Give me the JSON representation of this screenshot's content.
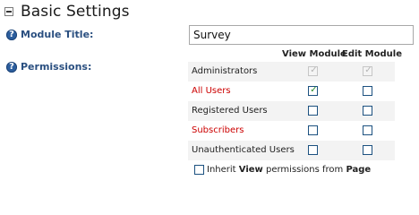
{
  "section": {
    "title": "Basic Settings",
    "icon": "collapse-minus-icon"
  },
  "module_title": {
    "label": "Module Title:",
    "value": "Survey"
  },
  "permissions": {
    "label": "Permissions:",
    "columns": {
      "view": "View Module",
      "edit": "Edit Module"
    },
    "roles": [
      {
        "name": "Administrators",
        "color": "#222222",
        "view": true,
        "edit": true,
        "disabled": true
      },
      {
        "name": "All Users",
        "color": "#cc0000",
        "view": true,
        "edit": false,
        "disabled": false
      },
      {
        "name": "Registered Users",
        "color": "#222222",
        "view": false,
        "edit": false,
        "disabled": false
      },
      {
        "name": "Subscribers",
        "color": "#cc0000",
        "view": false,
        "edit": false,
        "disabled": false
      },
      {
        "name": "Unauthenticated Users",
        "color": "#222222",
        "view": false,
        "edit": false,
        "disabled": false
      }
    ],
    "inherit": {
      "prefix": "Inherit",
      "view_word": "View",
      "middle": "permissions from",
      "page_word": "Page",
      "checked": false
    }
  },
  "colors": {
    "label_blue": "#2a4f80",
    "help_icon": "#2c5e9e",
    "special_role": "#cc0000",
    "check_green": "#2a8a2a"
  }
}
